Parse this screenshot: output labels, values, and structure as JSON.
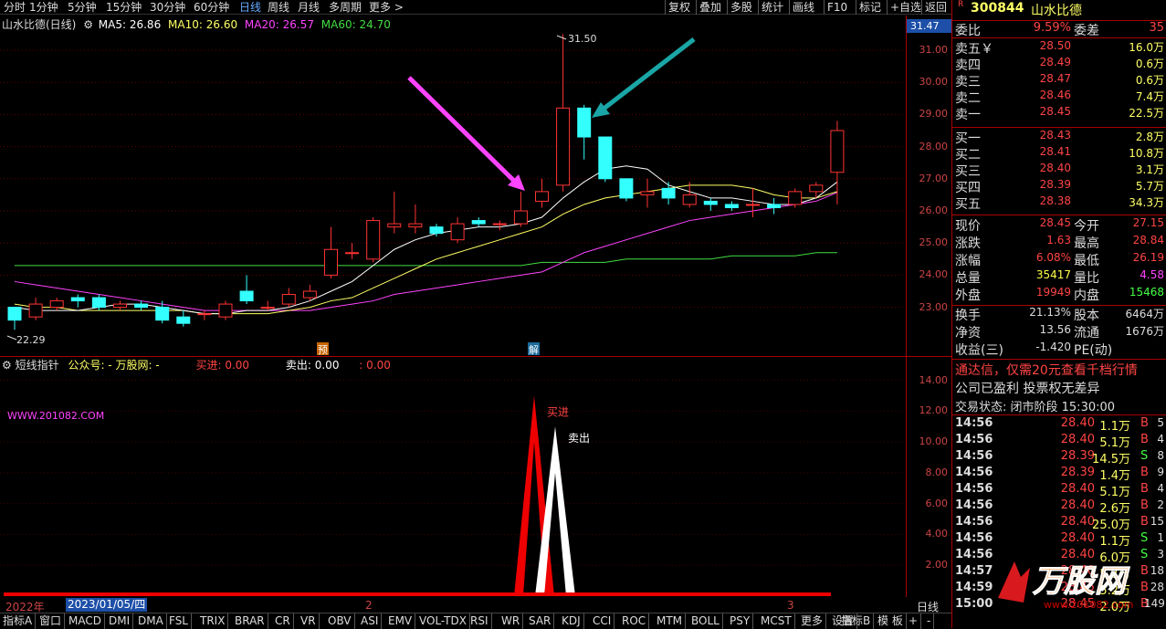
{
  "toolbar": {
    "periods": [
      "分时",
      "1分钟",
      "5分钟",
      "15分钟",
      "30分钟",
      "60分钟",
      "日线",
      "周线",
      "月线",
      "多周期",
      "更多 >"
    ],
    "active_period": "日线",
    "buttons": [
      "复权",
      "叠加",
      "多股",
      "统计",
      "画线",
      "F10",
      "标记",
      "+自选",
      "返回"
    ]
  },
  "main": {
    "title": "山水比德(日线)",
    "ma": [
      {
        "label": "MA5: 26.86",
        "color": "#ffffff"
      },
      {
        "label": "MA10: 26.60",
        "color": "#ffff66"
      },
      {
        "label": "MA20: 26.57",
        "color": "#ff44ff"
      },
      {
        "label": "MA60: 24.70",
        "color": "#44dd44"
      }
    ],
    "y_ticks": [
      "31.00",
      "30.00",
      "29.00",
      "28.00",
      "27.00",
      "26.00",
      "25.00",
      "24.00",
      "23.00"
    ],
    "current_price_tag": "31.47",
    "high_label": "31.50",
    "low_label": "22.29",
    "marker_yu": "预",
    "marker_jie": "解"
  },
  "indicator": {
    "name": "短线指针",
    "gzh": "公众号: - 万股网: -",
    "buy_label": "买进: 0.00",
    "sell_label": "卖出: 0.00",
    "extra": ": 0.00",
    "watermark": "WWW.201082.COM",
    "buy_peak_label": "买进",
    "sell_peak_label": "卖出",
    "y_ticks": [
      "14.00",
      "12.00",
      "10.00",
      "8.00",
      "6.00",
      "4.00",
      "2.00"
    ]
  },
  "datebar": {
    "year": "2022年",
    "date": "2023/01/05/四",
    "m2": "2",
    "m3": "3",
    "label": "日线"
  },
  "bottom_tabs": [
    "指标A",
    "窗口",
    "MACD",
    "DMI",
    "DMA",
    "FSL",
    "TRIX",
    "BRAR",
    "CR",
    "VR",
    "OBV",
    "ASI",
    "EMV",
    "VOL-TDX",
    "RSI",
    "WR",
    "SAR",
    "KDJ",
    "CCI",
    "ROC",
    "MTM",
    "BOLL",
    "PSY",
    "MCST",
    "更多",
    "设置"
  ],
  "bottom_right": [
    "指标B",
    "模 板",
    "+",
    "-"
  ],
  "quote": {
    "code": "300844",
    "name": "山水比德",
    "r": "R",
    "weibi_label": "委比",
    "weibi": "9.59%",
    "weicha_label": "委差",
    "weicha": "35",
    "asks": [
      {
        "label": "卖五￥",
        "price": "28.50",
        "vol": "16.0万"
      },
      {
        "label": "卖四",
        "price": "28.49",
        "vol": "0.6万"
      },
      {
        "label": "卖三",
        "price": "28.47",
        "vol": "0.6万"
      },
      {
        "label": "卖二",
        "price": "28.46",
        "vol": "7.4万"
      },
      {
        "label": "卖一",
        "price": "28.45",
        "vol": "22.5万"
      }
    ],
    "bids": [
      {
        "label": "买一",
        "price": "28.43",
        "vol": "2.8万"
      },
      {
        "label": "买二",
        "price": "28.41",
        "vol": "10.8万"
      },
      {
        "label": "买三",
        "price": "28.40",
        "vol": "3.1万"
      },
      {
        "label": "买四",
        "price": "28.39",
        "vol": "5.7万"
      },
      {
        "label": "买五",
        "price": "28.38",
        "vol": "34.3万"
      }
    ],
    "stats": [
      {
        "l1": "现价",
        "v1": "28.45",
        "c1": "#ff4444",
        "l2": "今开",
        "v2": "27.15",
        "c2": "#ff4444"
      },
      {
        "l1": "涨跌",
        "v1": "1.63",
        "c1": "#ff4444",
        "l2": "最高",
        "v2": "28.84",
        "c2": "#ff4444"
      },
      {
        "l1": "涨幅",
        "v1": "6.08%",
        "c1": "#ff4444",
        "l2": "最低",
        "v2": "26.19",
        "c2": "#ff4444"
      },
      {
        "l1": "总量",
        "v1": "35417",
        "c1": "#ffff44",
        "l2": "量比",
        "v2": "4.58",
        "c2": "#ff44ff"
      },
      {
        "l1": "外盘",
        "v1": "19949",
        "c1": "#ff4444",
        "l2": "内盘",
        "v2": "15468",
        "c2": "#44ff44"
      }
    ],
    "stats2": [
      {
        "l1": "换手",
        "v1": "21.13%",
        "l2": "股本",
        "v2": "6464万"
      },
      {
        "l1": "净资",
        "v1": "13.56",
        "l2": "流通",
        "v2": "1676万"
      },
      {
        "l1": "收益(三)",
        "v1": "-1.420",
        "l2": "PE(动)",
        "v2": ""
      }
    ],
    "ad": "通达信，仅需20元查看千档行情",
    "info": "公司已盈利 投票权无差异",
    "status": "交易状态: 闭市阶段 15:30:00",
    "ticks": [
      {
        "t": "14:56",
        "p": "28.40",
        "v": "1.1万",
        "bs": "B",
        "n": "5"
      },
      {
        "t": "14:56",
        "p": "28.40",
        "v": "5.1万",
        "bs": "B",
        "n": "4"
      },
      {
        "t": "14:56",
        "p": "28.39",
        "v": "14.5万",
        "bs": "S",
        "n": "8"
      },
      {
        "t": "14:56",
        "p": "28.39",
        "v": "1.4万",
        "bs": "B",
        "n": "9"
      },
      {
        "t": "14:56",
        "p": "28.40",
        "v": "5.1万",
        "bs": "B",
        "n": "4"
      },
      {
        "t": "14:56",
        "p": "28.40",
        "v": "2.6万",
        "bs": "B",
        "n": "2"
      },
      {
        "t": "14:56",
        "p": "28.40",
        "v": "25.0万",
        "bs": "B",
        "n": "15"
      },
      {
        "t": "14:56",
        "p": "28.40",
        "v": "1.1万",
        "bs": "S",
        "n": "1"
      },
      {
        "t": "14:56",
        "p": "28.40",
        "v": "6.0万",
        "bs": "S",
        "n": "3"
      },
      {
        "t": "14:57",
        "p": "28.40",
        "v": "5.7万",
        "bs": "B",
        "n": "18"
      },
      {
        "t": "14:59",
        "p": "28.45",
        "v": "5.2万",
        "bs": "B",
        "n": "28"
      },
      {
        "t": "15:00",
        "p": "28.45",
        "v": "2.0万",
        "bs": "B",
        "n": "149"
      }
    ]
  },
  "logo": "万股网",
  "logo_sub": "www.201082.com",
  "chart_data": {
    "type": "candlestick",
    "ylim": [
      22.29,
      31.5
    ],
    "candles": [
      {
        "o": 23.0,
        "c": 22.6,
        "h": 23.0,
        "l": 22.3
      },
      {
        "o": 22.7,
        "c": 23.1,
        "h": 23.3,
        "l": 22.6
      },
      {
        "o": 23.0,
        "c": 23.2,
        "h": 23.3,
        "l": 22.9
      },
      {
        "o": 23.3,
        "c": 23.2,
        "h": 23.4,
        "l": 23.0
      },
      {
        "o": 23.3,
        "c": 23.0,
        "h": 23.4,
        "l": 22.9
      },
      {
        "o": 23.0,
        "c": 23.1,
        "h": 23.2,
        "l": 22.9
      },
      {
        "o": 23.1,
        "c": 23.0,
        "h": 23.2,
        "l": 22.9
      },
      {
        "o": 23.0,
        "c": 22.6,
        "h": 23.2,
        "l": 22.5
      },
      {
        "o": 22.7,
        "c": 22.5,
        "h": 22.9,
        "l": 22.4
      },
      {
        "o": 22.8,
        "c": 22.8,
        "h": 22.9,
        "l": 22.6
      },
      {
        "o": 22.7,
        "c": 23.1,
        "h": 23.2,
        "l": 22.6
      },
      {
        "o": 23.5,
        "c": 23.2,
        "h": 24.0,
        "l": 23.1
      },
      {
        "o": 23.0,
        "c": 23.0,
        "h": 23.2,
        "l": 22.9
      },
      {
        "o": 23.1,
        "c": 23.4,
        "h": 23.6,
        "l": 23.0
      },
      {
        "o": 23.3,
        "c": 23.5,
        "h": 23.7,
        "l": 23.2
      },
      {
        "o": 24.0,
        "c": 24.8,
        "h": 25.5,
        "l": 23.9
      },
      {
        "o": 24.7,
        "c": 24.7,
        "h": 25.0,
        "l": 24.5
      },
      {
        "o": 24.5,
        "c": 25.7,
        "h": 25.8,
        "l": 24.4
      },
      {
        "o": 25.5,
        "c": 25.6,
        "h": 26.6,
        "l": 25.3
      },
      {
        "o": 25.5,
        "c": 25.6,
        "h": 26.2,
        "l": 25.3
      },
      {
        "o": 25.5,
        "c": 25.3,
        "h": 25.6,
        "l": 25.2
      },
      {
        "o": 25.1,
        "c": 25.6,
        "h": 25.8,
        "l": 25.0
      },
      {
        "o": 25.7,
        "c": 25.6,
        "h": 25.8,
        "l": 25.5
      },
      {
        "o": 25.6,
        "c": 25.6,
        "h": 25.7,
        "l": 25.4
      },
      {
        "o": 25.6,
        "c": 26.0,
        "h": 26.6,
        "l": 25.5
      },
      {
        "o": 26.3,
        "c": 26.6,
        "h": 27.0,
        "l": 26.1
      },
      {
        "o": 26.8,
        "c": 29.2,
        "h": 31.5,
        "l": 26.6
      },
      {
        "o": 29.2,
        "c": 28.3,
        "h": 29.3,
        "l": 27.6
      },
      {
        "o": 28.3,
        "c": 27.0,
        "h": 28.3,
        "l": 26.9
      },
      {
        "o": 27.0,
        "c": 26.4,
        "h": 27.0,
        "l": 26.3
      },
      {
        "o": 26.5,
        "c": 26.6,
        "h": 27.0,
        "l": 26.1
      },
      {
        "o": 26.7,
        "c": 26.4,
        "h": 26.9,
        "l": 26.2
      },
      {
        "o": 26.2,
        "c": 26.5,
        "h": 26.9,
        "l": 26.1
      },
      {
        "o": 26.3,
        "c": 26.2,
        "h": 26.4,
        "l": 26.0
      },
      {
        "o": 26.2,
        "c": 26.1,
        "h": 26.3,
        "l": 26.0
      },
      {
        "o": 26.2,
        "c": 26.2,
        "h": 26.7,
        "l": 25.8
      },
      {
        "o": 26.2,
        "c": 26.1,
        "h": 26.4,
        "l": 25.9
      },
      {
        "o": 26.2,
        "c": 26.6,
        "h": 26.7,
        "l": 26.1
      },
      {
        "o": 26.6,
        "c": 26.8,
        "h": 26.9,
        "l": 26.4
      },
      {
        "o": 27.2,
        "c": 28.5,
        "h": 28.8,
        "l": 26.2
      }
    ],
    "ma5": [
      23.0,
      22.9,
      22.9,
      22.9,
      23.0,
      23.1,
      23.1,
      23.0,
      22.9,
      22.8,
      22.8,
      22.9,
      22.9,
      23.0,
      23.2,
      23.5,
      23.8,
      24.3,
      24.8,
      25.1,
      25.3,
      25.4,
      25.5,
      25.5,
      25.6,
      25.8,
      26.4,
      26.9,
      27.3,
      27.4,
      27.3,
      26.8,
      26.6,
      26.4,
      26.4,
      26.3,
      26.2,
      26.2,
      26.4,
      26.9
    ],
    "ma10": [
      23.1,
      23.0,
      23.0,
      22.9,
      22.9,
      22.9,
      22.9,
      22.9,
      22.9,
      22.8,
      22.8,
      22.8,
      22.8,
      22.9,
      23.0,
      23.2,
      23.3,
      23.6,
      23.9,
      24.2,
      24.5,
      24.7,
      24.9,
      25.1,
      25.3,
      25.5,
      25.9,
      26.2,
      26.4,
      26.5,
      26.6,
      26.7,
      26.8,
      26.8,
      26.8,
      26.7,
      26.5,
      26.4,
      26.4,
      26.6
    ],
    "ma20": [
      23.8,
      23.7,
      23.6,
      23.5,
      23.4,
      23.3,
      23.2,
      23.1,
      23.0,
      22.9,
      22.9,
      22.9,
      22.9,
      22.9,
      22.9,
      23.0,
      23.1,
      23.2,
      23.4,
      23.5,
      23.6,
      23.7,
      23.8,
      23.9,
      24.0,
      24.1,
      24.4,
      24.7,
      24.9,
      25.1,
      25.3,
      25.5,
      25.7,
      25.8,
      25.9,
      26.0,
      26.1,
      26.2,
      26.3,
      26.57
    ],
    "ma60": [
      24.3,
      24.3,
      24.3,
      24.3,
      24.3,
      24.3,
      24.3,
      24.3,
      24.3,
      24.3,
      24.3,
      24.3,
      24.3,
      24.3,
      24.3,
      24.3,
      24.3,
      24.3,
      24.3,
      24.3,
      24.3,
      24.3,
      24.3,
      24.3,
      24.3,
      24.4,
      24.4,
      24.4,
      24.4,
      24.5,
      24.5,
      24.5,
      24.5,
      24.5,
      24.6,
      24.6,
      24.6,
      24.6,
      24.7,
      24.7
    ],
    "indicator": {
      "buy_peak": 13.0,
      "sell_peak": 11.0,
      "ylim": [
        0,
        15
      ]
    }
  }
}
